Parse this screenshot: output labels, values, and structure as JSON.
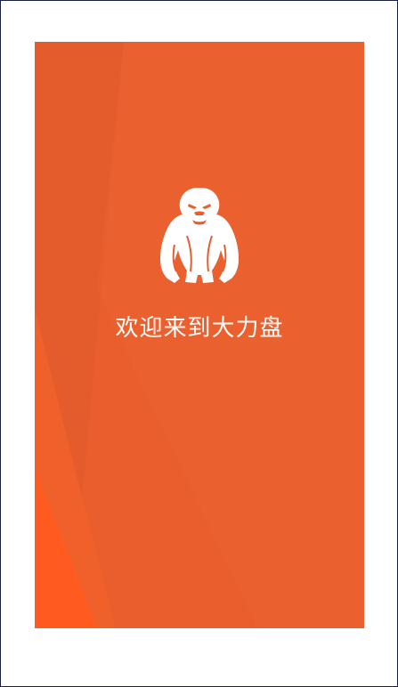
{
  "splash": {
    "welcome_text": "欢迎来到大力盘",
    "logo_icon": "gorilla-icon",
    "background_color": "#ea5e2d",
    "accent_color": "#ff5a1f",
    "text_color": "#ffffff"
  }
}
